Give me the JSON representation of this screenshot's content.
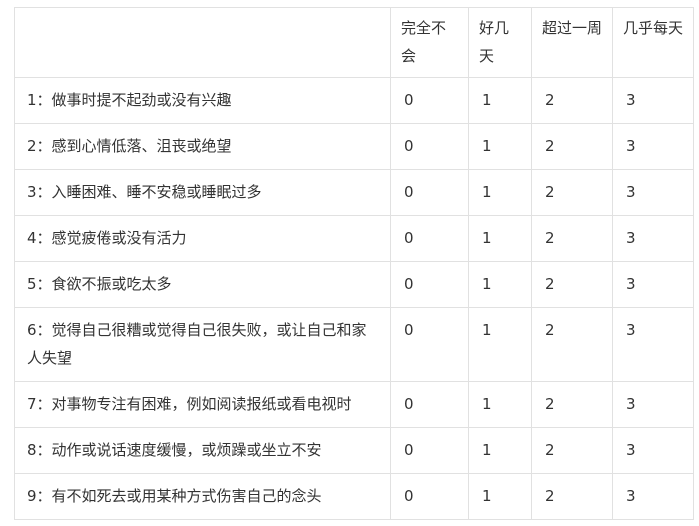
{
  "table": {
    "headers": [
      "",
      "完全不会",
      "好几天",
      "超过一周",
      "几乎每天"
    ],
    "rows": [
      {
        "item": "1：做事时提不起劲或没有兴趣",
        "scores": [
          "0",
          "1",
          "2",
          "3"
        ]
      },
      {
        "item": "2：感到心情低落、沮丧或绝望",
        "scores": [
          "0",
          "1",
          "2",
          "3"
        ]
      },
      {
        "item": "3：入睡困难、睡不安稳或睡眠过多",
        "scores": [
          "0",
          "1",
          "2",
          "3"
        ]
      },
      {
        "item": "4：感觉疲倦或没有活力",
        "scores": [
          "0",
          "1",
          "2",
          "3"
        ]
      },
      {
        "item": "5：食欲不振或吃太多",
        "scores": [
          "0",
          "1",
          "2",
          "3"
        ]
      },
      {
        "item": "6：觉得自己很糟或觉得自己很失败，或让自己和家人失望",
        "scores": [
          "0",
          "1",
          "2",
          "3"
        ]
      },
      {
        "item": "7：对事物专注有困难，例如阅读报纸或看电视时",
        "scores": [
          "0",
          "1",
          "2",
          "3"
        ]
      },
      {
        "item": "8：动作或说话速度缓慢，或烦躁或坐立不安",
        "scores": [
          "0",
          "1",
          "2",
          "3"
        ]
      },
      {
        "item": "9：有不如死去或用某种方式伤害自己的念头",
        "scores": [
          "0",
          "1",
          "2",
          "3"
        ]
      }
    ]
  }
}
